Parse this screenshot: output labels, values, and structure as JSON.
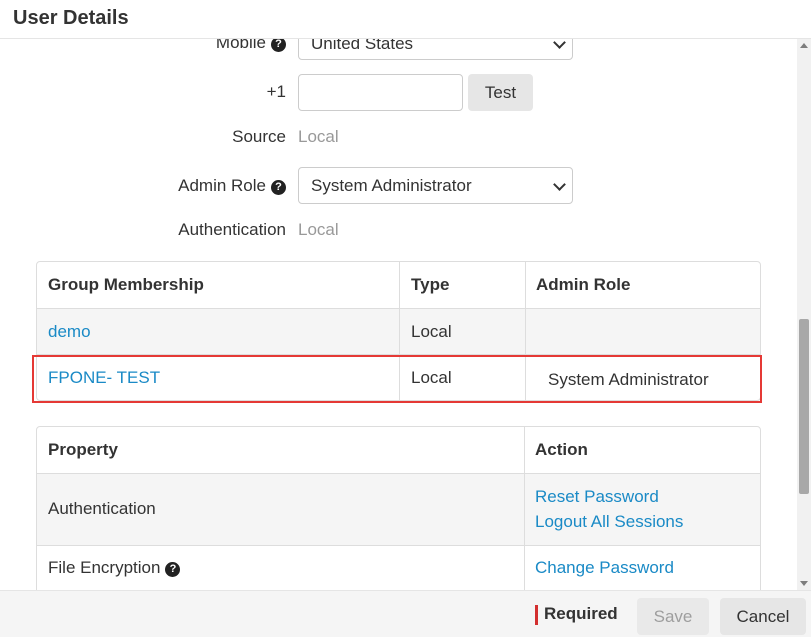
{
  "dialog": {
    "title": "User Details"
  },
  "form": {
    "mobile_label": "Mobile",
    "mobile_country": "United States",
    "phone_prefix": "+1",
    "phone_value": "",
    "test_button": "Test",
    "source_label": "Source",
    "source_value": "Local",
    "admin_role_label": "Admin Role",
    "admin_role_value": "System Administrator",
    "auth_label": "Authentication",
    "auth_value": "Local"
  },
  "groups_table": {
    "headers": [
      "Group Membership",
      "Type",
      "Admin Role"
    ],
    "rows": [
      {
        "group": "demo",
        "type": "Local",
        "role": ""
      },
      {
        "group": "FPONE- TEST",
        "type": "Local",
        "role": "System Administrator"
      }
    ]
  },
  "property_table": {
    "headers": [
      "Property",
      "Action"
    ],
    "rows": [
      {
        "property": "Authentication",
        "actions": [
          "Reset Password",
          "Logout All Sessions"
        ]
      },
      {
        "property": "File Encryption",
        "actions": [
          "Change Password"
        ]
      }
    ]
  },
  "footer": {
    "required_label": "Required",
    "save_label": "Save",
    "cancel_label": "Cancel"
  },
  "colors": {
    "link": "#1a8ac6",
    "highlight": "#e53935",
    "required_marker": "#d32f2f"
  },
  "icons": [
    "help-icon",
    "chevron-down-icon"
  ]
}
